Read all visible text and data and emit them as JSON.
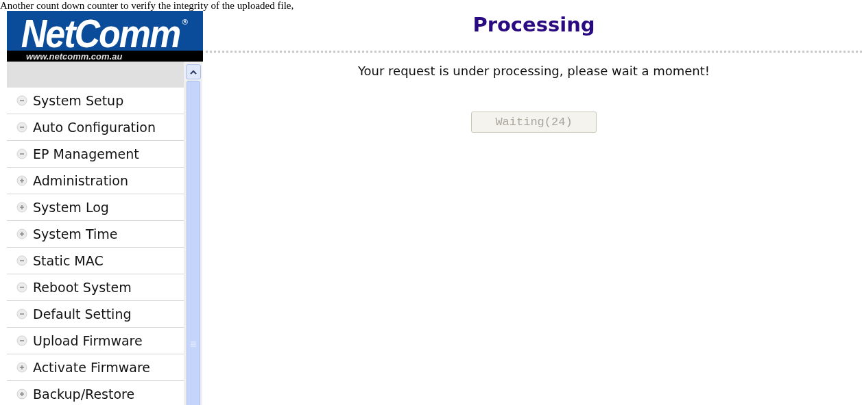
{
  "caption": "Another count down counter to verify the integrity of the uploaded file,",
  "logo": {
    "brand": "NetComm",
    "registered": "®",
    "url": "www.netcomm.com.au"
  },
  "sidebar": {
    "items": [
      {
        "label": "System Setup",
        "expanded": true
      },
      {
        "label": "Auto Configuration",
        "expanded": true
      },
      {
        "label": "EP Management",
        "expanded": true
      },
      {
        "label": "Administration",
        "expanded": false
      },
      {
        "label": "System Log",
        "expanded": false
      },
      {
        "label": "System Time",
        "expanded": false
      },
      {
        "label": "Static MAC",
        "expanded": true
      },
      {
        "label": "Reboot System",
        "expanded": true
      },
      {
        "label": "Default Setting",
        "expanded": true
      },
      {
        "label": "Upload Firmware",
        "expanded": true
      },
      {
        "label": "Activate Firmware",
        "expanded": false
      },
      {
        "label": "Backup/Restore",
        "expanded": false
      }
    ]
  },
  "main": {
    "title": "Processing",
    "message": "Your request is under processing, please wait a moment!",
    "button": {
      "label": "Waiting(24)",
      "disabled": true
    }
  }
}
